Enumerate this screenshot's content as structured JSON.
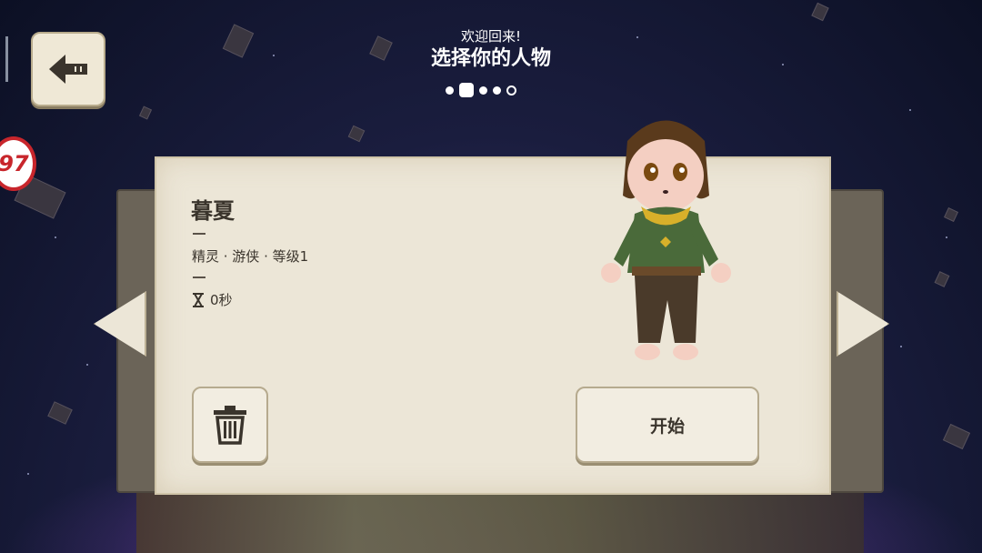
{
  "header": {
    "welcome": "欢迎回来!",
    "title": "选择你的人物"
  },
  "pagination": {
    "count": 5,
    "active_index": 1
  },
  "character": {
    "name": "暮夏",
    "details": "精灵 · 游侠 · 等级1",
    "playtime": "0秒"
  },
  "buttons": {
    "start_label": "开始"
  },
  "side_badge": {
    "text": "97"
  },
  "colors": {
    "panel": "#ece6d7",
    "text": "#3a342c",
    "background": "#1a1d3e"
  },
  "icons": {
    "back": "arrow-left-icon",
    "delete": "trash-icon",
    "playtime": "hourglass-icon",
    "prev": "chevron-left-icon",
    "next": "chevron-right-icon"
  }
}
